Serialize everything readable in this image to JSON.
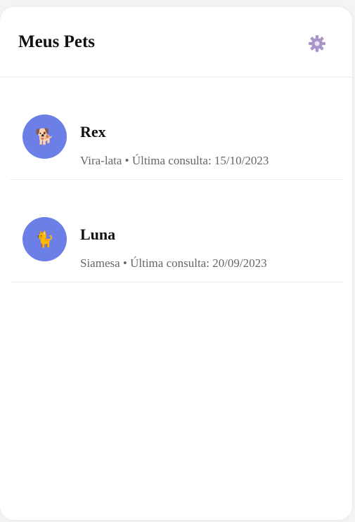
{
  "header": {
    "title": "Meus Pets",
    "settings_icon": "gear-icon"
  },
  "pets": [
    {
      "name": "Rex",
      "breed": "Vira-lata",
      "separator": "•",
      "last_visit_label": "Última consulta:",
      "last_visit_date": "15/10/2023",
      "info": "Vira-lata • Última consulta: 15/10/2023",
      "avatar_icon": "dog-icon",
      "avatar_glyph": "🐕"
    },
    {
      "name": "Luna",
      "breed": "Siamesa",
      "separator": "•",
      "last_visit_label": "Última consulta:",
      "last_visit_date": "20/09/2023",
      "info": "Siamesa • Última consulta: 20/09/2023",
      "avatar_icon": "cat-icon",
      "avatar_glyph": "🐈"
    }
  ],
  "colors": {
    "avatar_bg": "#6b7fe6",
    "gear": "#a995c9",
    "text_primary": "#111111",
    "text_secondary": "#666666"
  }
}
